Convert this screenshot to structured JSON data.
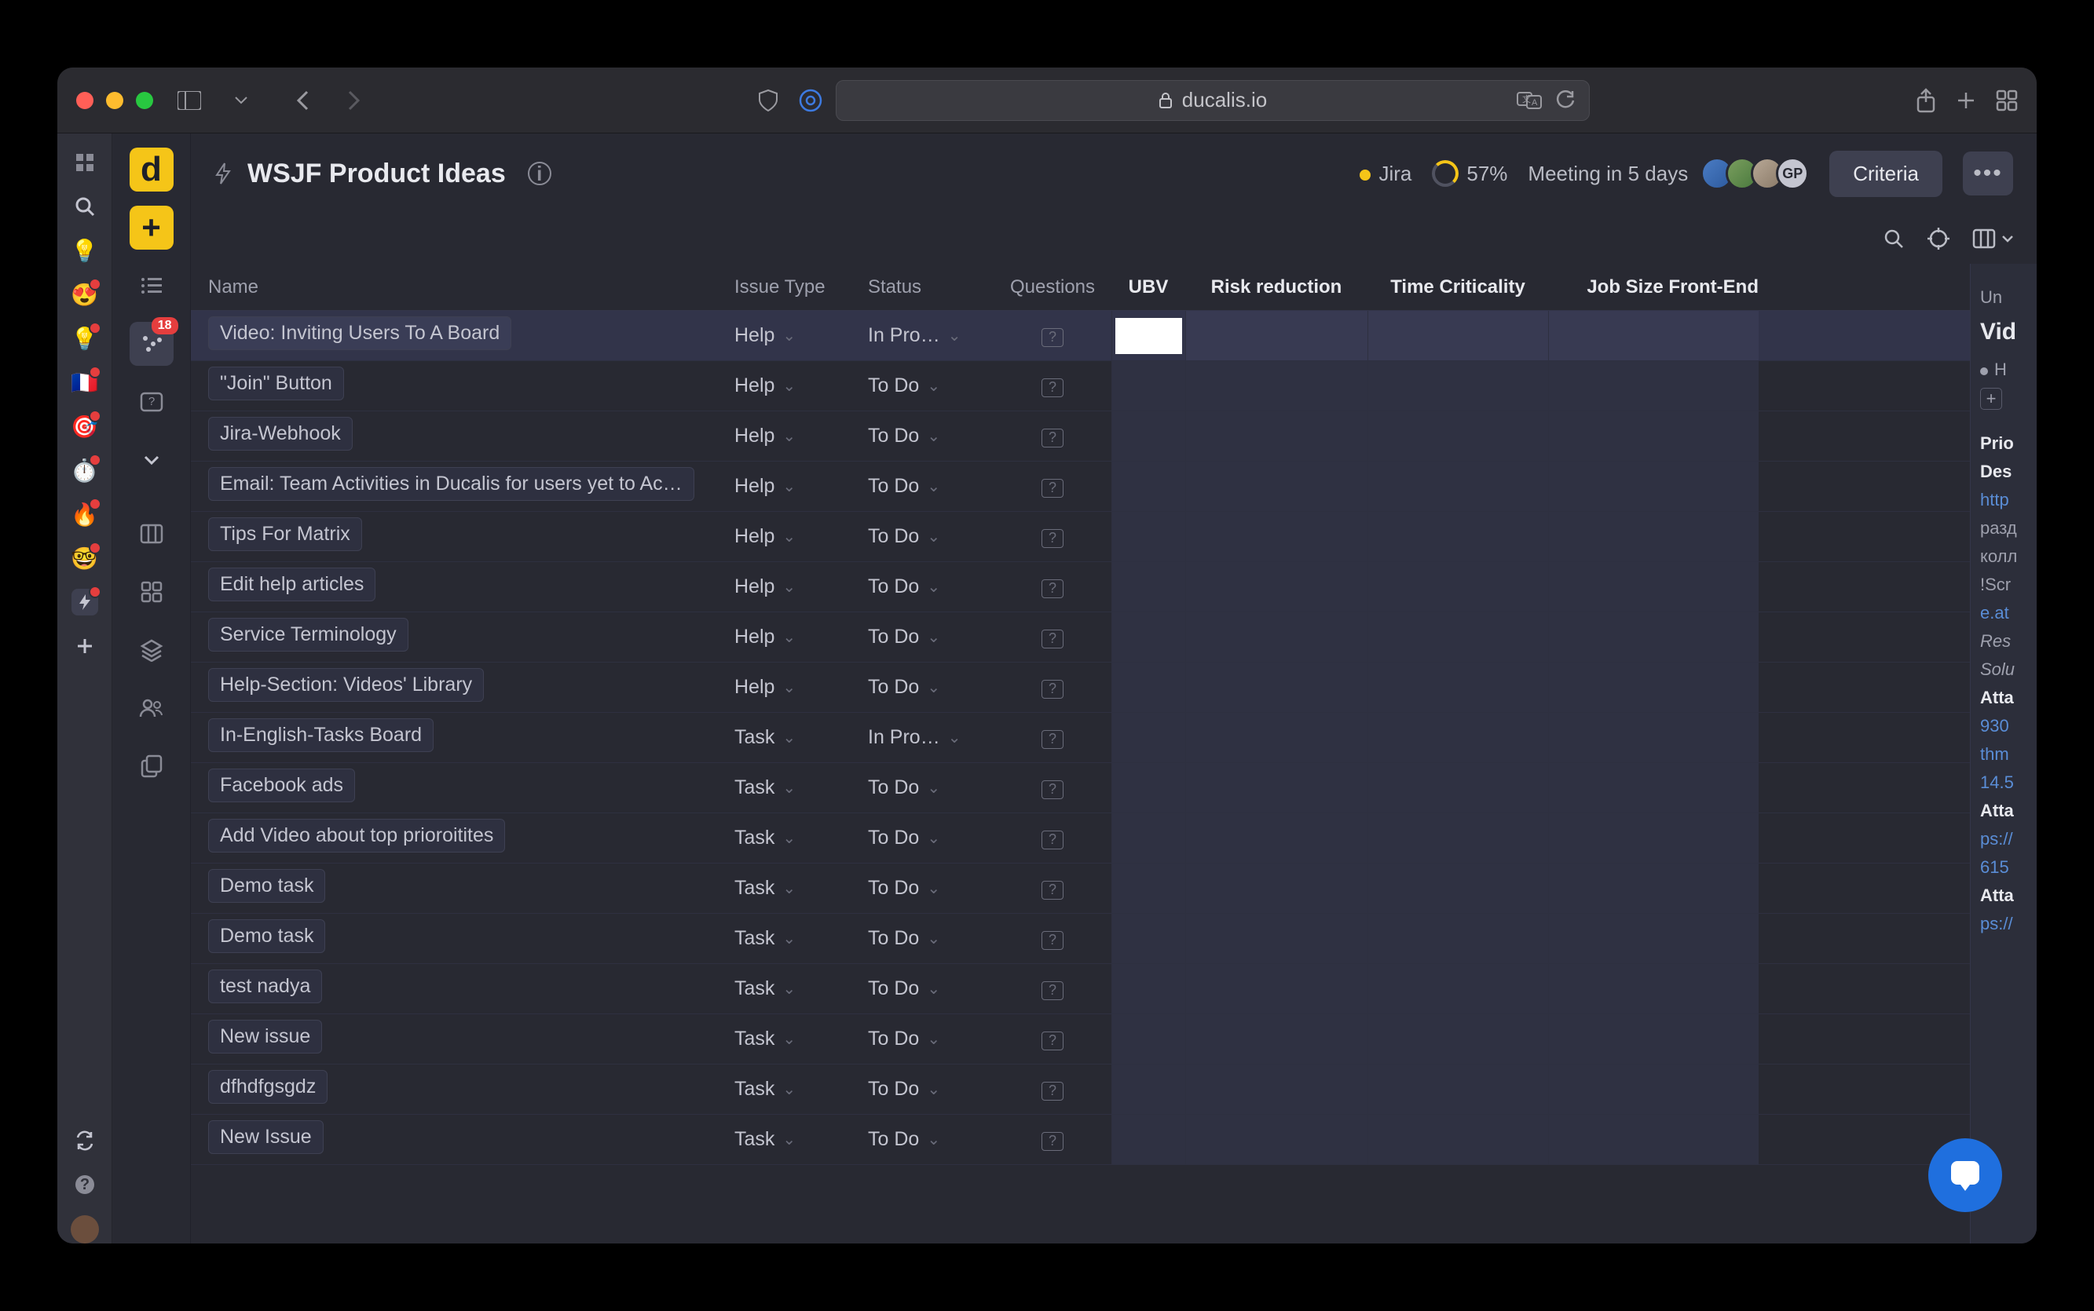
{
  "browser": {
    "url_host": "ducalis.io"
  },
  "header": {
    "title": "WSJF Product Ideas",
    "integration": "Jira",
    "progress": "57%",
    "meeting": "Meeting in 5 days",
    "avatar_initials": "GP",
    "criteria_btn": "Criteria"
  },
  "rail2": {
    "badge": "18"
  },
  "columns": {
    "name": "Name",
    "type": "Issue Type",
    "status": "Status",
    "questions": "Questions",
    "ubv": "UBV",
    "risk": "Risk reduction",
    "tc": "Time Criticality",
    "js": "Job Size Front-End"
  },
  "rows": [
    {
      "name": "Video: Inviting Users To A Board",
      "type": "Help",
      "status": "In Pro…",
      "selected": true
    },
    {
      "name": "\"Join\" Button",
      "type": "Help",
      "status": "To Do"
    },
    {
      "name": "Jira-Webhook",
      "type": "Help",
      "status": "To Do"
    },
    {
      "name": "Email: Team Activities in Ducalis for users yet to Ac…",
      "type": "Help",
      "status": "To Do"
    },
    {
      "name": "Tips For Matrix",
      "type": "Help",
      "status": "To Do"
    },
    {
      "name": "Edit help articles",
      "type": "Help",
      "status": "To Do"
    },
    {
      "name": "Service Terminology",
      "type": "Help",
      "status": "To Do"
    },
    {
      "name": "Help-Section: Videos' Library",
      "type": "Help",
      "status": "To Do"
    },
    {
      "name": "In-English-Tasks Board",
      "type": "Task",
      "status": "In Pro…"
    },
    {
      "name": "Facebook ads",
      "type": "Task",
      "status": "To Do"
    },
    {
      "name": "Add Video about top prioroitites",
      "type": "Task",
      "status": "To Do"
    },
    {
      "name": "Demo task",
      "type": "Task",
      "status": "To Do"
    },
    {
      "name": "Demo task",
      "type": "Task",
      "status": "To Do"
    },
    {
      "name": "test nadya",
      "type": "Task",
      "status": "To Do"
    },
    {
      "name": "New issue",
      "type": "Task",
      "status": "To Do"
    },
    {
      "name": "dfhdfgsgdz",
      "type": "Task",
      "status": "To Do"
    },
    {
      "name": "New Issue",
      "type": "Task",
      "status": "To Do"
    }
  ],
  "sidepanel": {
    "breadcrumb": "Un",
    "title": "Vid",
    "tag": "H",
    "prio": "Prio",
    "desc": "Des",
    "link1": "http",
    "l1": "разд",
    "l2": "колл",
    "l3": "!Scr",
    "link2": "e.at",
    "res": "Res",
    "sol": "Solu",
    "att1": "Atta",
    "a1": "930",
    "a2": "thm",
    "a3": "14.5",
    "att2": "Atta",
    "b1": "ps://",
    "b2": "615",
    "att3": "Atta",
    "c1": "ps://"
  }
}
